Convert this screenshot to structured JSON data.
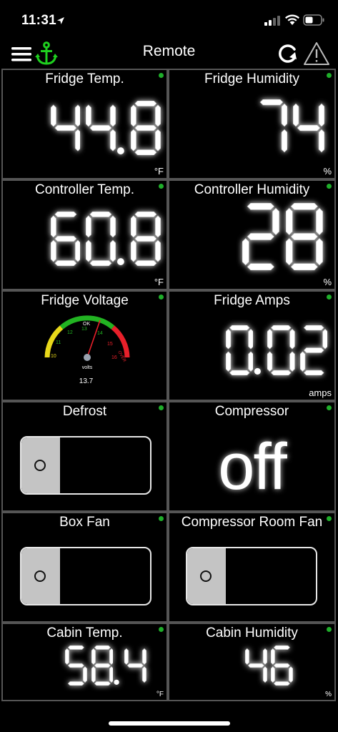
{
  "status": {
    "time": "11:31"
  },
  "nav": {
    "title": "Remote"
  },
  "colors": {
    "accent_green": "#1fd01f",
    "dot_green": "#1fae2a",
    "gauge_red": "#e8202a",
    "gauge_yellow": "#e8d81a"
  },
  "tiles": {
    "fridge_temp": {
      "title": "Fridge Temp.",
      "value": "44.8",
      "unit": "°F"
    },
    "fridge_humidity": {
      "title": "Fridge Humidity",
      "value": "74",
      "unit": "%"
    },
    "controller_temp": {
      "title": "Controller Temp.",
      "value": "60.8",
      "unit": "°F"
    },
    "controller_humidity": {
      "title": "Controller Humidity",
      "value": "28",
      "unit": "%"
    },
    "fridge_voltage": {
      "title": "Fridge Voltage",
      "gauge_label": "volts",
      "value": "13.7",
      "ok_label": "OK",
      "over_label": "OVER",
      "ticks": [
        "10",
        "11",
        "12",
        "13",
        "14",
        "15",
        "16"
      ]
    },
    "fridge_amps": {
      "title": "Fridge Amps",
      "value": "0.02",
      "unit": "amps"
    },
    "defrost": {
      "title": "Defrost",
      "state": "off"
    },
    "compressor": {
      "title": "Compressor",
      "value": "off"
    },
    "box_fan": {
      "title": "Box Fan",
      "state": "off"
    },
    "compressor_room_fan": {
      "title": "Compressor Room Fan",
      "state": "off"
    },
    "cabin_temp": {
      "title": "Cabin Temp.",
      "value": "58.4",
      "unit": "°F"
    },
    "cabin_humidity": {
      "title": "Cabin Humidity",
      "value": "46",
      "unit": "%"
    }
  }
}
